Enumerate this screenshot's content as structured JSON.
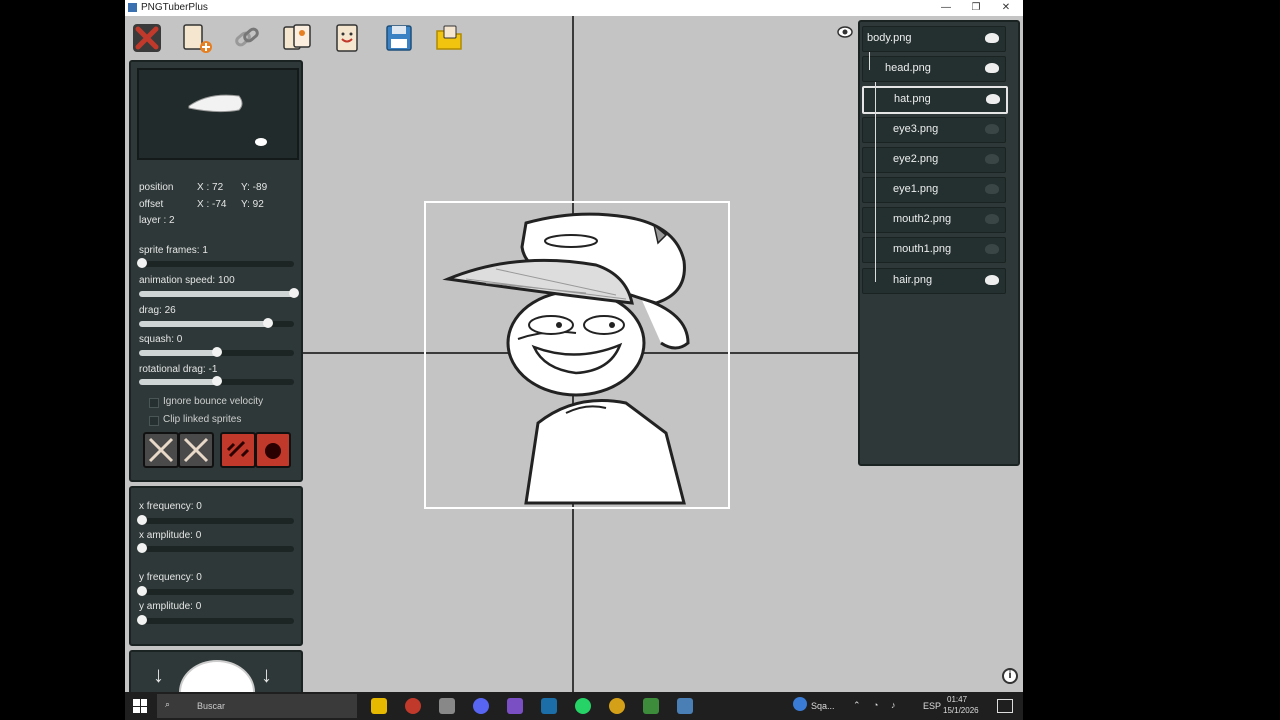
{
  "window": {
    "title": "PNGTuberPlus",
    "controls": [
      "—",
      "❐",
      "✕"
    ]
  },
  "toolbar": [
    {
      "name": "delete-sprite-button",
      "icon": "x-icon"
    },
    {
      "name": "add-sprite-button",
      "icon": "card-plus-icon"
    },
    {
      "name": "link-sprite-button",
      "icon": "chain-icon"
    },
    {
      "name": "duplicate-sprite-button",
      "icon": "cards-icon"
    },
    {
      "name": "new-file-button",
      "icon": "card-smile-icon"
    },
    {
      "name": "save-button",
      "icon": "floppy-icon"
    },
    {
      "name": "open-button",
      "icon": "folder-icon"
    }
  ],
  "props": {
    "position_label": "position",
    "position_x": "X : 72",
    "position_y": "Y: -89",
    "offset_label": "offset",
    "offset_x": "X : -74",
    "offset_y": "Y: 92",
    "layer": "layer : 2",
    "sprite_frames": "sprite frames: 1",
    "animation_speed": "animation speed: 100",
    "drag": "drag: 26",
    "squash": "squash: 0",
    "rotational_drag": "rotational drag: -1",
    "ignore_bounce": "Ignore bounce velocity",
    "clip_linked": "Clip linked sprites",
    "sliders": {
      "sprite_frames": 0.02,
      "animation_speed": 1.0,
      "drag": 0.83,
      "squash": 0.5,
      "rotational_drag": 0.5
    }
  },
  "wobble": {
    "x_frequency": "x frequency: 0",
    "x_amplitude": "x amplitude: 0",
    "y_frequency": "y frequency: 0",
    "y_amplitude": "y amplitude: 0",
    "sliders": {
      "x_frequency": 0.02,
      "x_amplitude": 0.02,
      "y_frequency": 0.02,
      "y_amplitude": 0.02
    }
  },
  "bottom_panel": {
    "arrow_left": "↓",
    "arrow_right": "↓"
  },
  "layers": [
    {
      "name": "body.png",
      "depth": 0
    },
    {
      "name": "head.png",
      "depth": 1
    },
    {
      "name": "hat.png",
      "depth": 2,
      "selected": true
    },
    {
      "name": "eye3.png",
      "depth": 2
    },
    {
      "name": "eye2.png",
      "depth": 2
    },
    {
      "name": "eye1.png",
      "depth": 2
    },
    {
      "name": "mouth2.png",
      "depth": 2
    },
    {
      "name": "mouth1.png",
      "depth": 2
    },
    {
      "name": "hair.png",
      "depth": 2
    }
  ],
  "taskbar": {
    "search_placeholder": "Buscar",
    "lang": "ESP",
    "time": "01:47",
    "date": "15/1/2026",
    "weather": "Sqa..."
  },
  "colors": {
    "panel": "#2e3838",
    "canvas": "#c4c4c4",
    "accent_red": "#c0392b"
  }
}
